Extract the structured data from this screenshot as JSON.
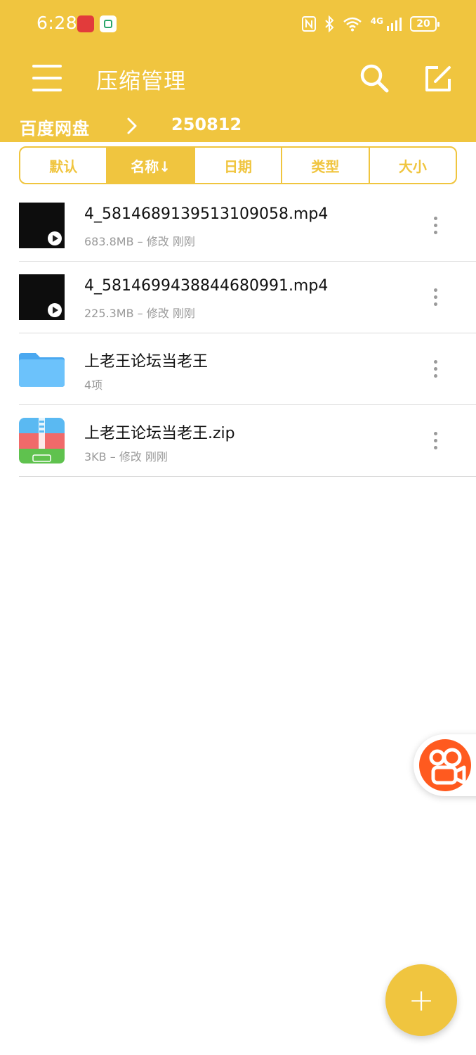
{
  "status_bar": {
    "time": "6:28",
    "network": "4G",
    "battery": "20"
  },
  "app_bar": {
    "title": "压缩管理"
  },
  "breadcrumb": {
    "root": "百度网盘",
    "current": "250812"
  },
  "sort_tabs": [
    {
      "label": "默认",
      "active": false
    },
    {
      "label": "名称↓",
      "active": true
    },
    {
      "label": "日期",
      "active": false
    },
    {
      "label": "类型",
      "active": false
    },
    {
      "label": "大小",
      "active": false
    }
  ],
  "files": [
    {
      "name": "4_5814689139513109058.mp4",
      "meta": "683.8MB – 修改 刚刚",
      "type": "video"
    },
    {
      "name": "4_5814699438844680991.mp4",
      "meta": "225.3MB – 修改 刚刚",
      "type": "video"
    },
    {
      "name": "上老王论坛当老王",
      "meta": "4项",
      "type": "folder"
    },
    {
      "name": "上老王论坛当老王.zip",
      "meta": "3KB – 修改 刚刚",
      "type": "zip"
    }
  ],
  "fab": {
    "label": "+"
  },
  "colors": {
    "primary": "#f0c53f",
    "floating_app": "#ff5a1f"
  }
}
